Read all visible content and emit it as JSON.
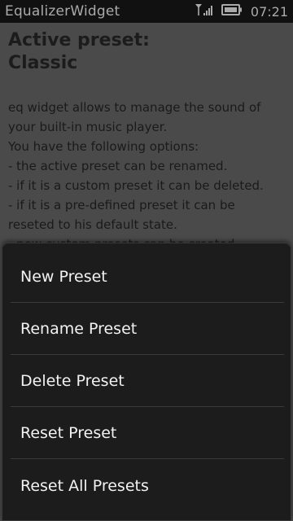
{
  "status_bar": {
    "app_title": "EqualizerWidget",
    "time": "07:21",
    "icons": [
      "signal-icon",
      "battery-icon"
    ]
  },
  "content": {
    "heading_line1": "Active preset:",
    "heading_line2": "Classic",
    "description": [
      "eq widget allows to manage the sound of",
      "your built-in music player.",
      "You have the following options:",
      "- the active preset can be renamed.",
      "- if it is a custom preset it can be deleted.",
      "- if it is a pre-defined preset it can be",
      "reseted to his default state.",
      "- new custom presets can be created."
    ]
  },
  "menu": {
    "items": [
      {
        "label": "New Preset"
      },
      {
        "label": "Rename Preset"
      },
      {
        "label": "Delete Preset"
      },
      {
        "label": "Reset Preset"
      },
      {
        "label": "Reset All Presets"
      }
    ]
  }
}
